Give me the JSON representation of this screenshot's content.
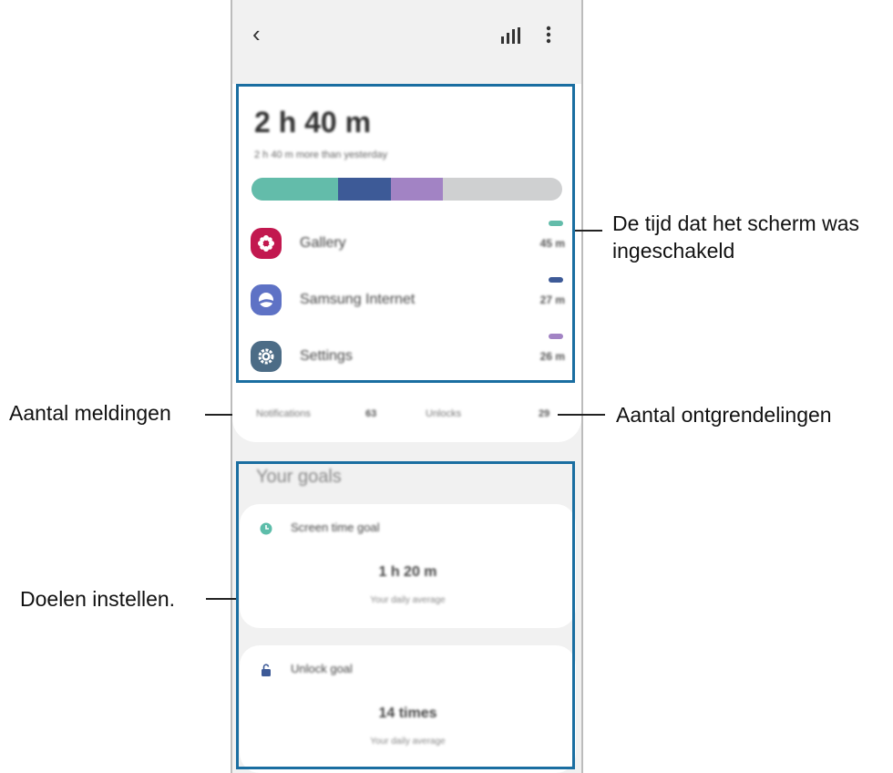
{
  "header": {
    "back_glyph": "‹",
    "stats_icon": "bar-chart-icon",
    "more_icon": "more-vertical-icon"
  },
  "summary": {
    "total_time": "2 h 40 m",
    "comparison": "2 h 40 m more than yesterday",
    "usage_segments": [
      {
        "app": "Gallery",
        "color": "#63bcaa",
        "fraction": 0.28
      },
      {
        "app": "Samsung Internet",
        "color": "#3d5a97",
        "fraction": 0.17
      },
      {
        "app": "Settings",
        "color": "#a283c4",
        "fraction": 0.165
      }
    ],
    "bar_remaining_color": "#cfd0d1"
  },
  "apps": [
    {
      "name": "Gallery",
      "time": "45 m",
      "icon": "gallery-icon",
      "icon_color": "#c2184f",
      "bar_color": "#63bcaa"
    },
    {
      "name": "Samsung Internet",
      "time": "27 m",
      "icon": "samsung-internet-icon",
      "icon_color": "#5e72c5",
      "bar_color": "#3d5a97"
    },
    {
      "name": "Settings",
      "time": "26 m",
      "icon": "settings-icon",
      "icon_color": "#4c6c86",
      "bar_color": "#a283c4"
    }
  ],
  "stats": {
    "notifications_label": "Notifications",
    "notifications_value": "63",
    "unlocks_label": "Unlocks",
    "unlocks_value": "29"
  },
  "goals": {
    "title": "Your goals",
    "screen_time": {
      "name": "Screen time goal",
      "value": "1 h 20 m",
      "caption": "Your daily average",
      "icon": "clock-icon"
    },
    "unlock": {
      "name": "Unlock goal",
      "value": "14 times",
      "caption": "Your daily average",
      "icon": "unlock-icon"
    }
  },
  "callouts": {
    "screen_time_line1": "De tijd dat het scherm was",
    "screen_time_line2": "ingeschakeld",
    "notifications": "Aantal meldingen",
    "unlocks": "Aantal ontgrendelingen",
    "goals": "Doelen instellen."
  },
  "colors": {
    "highlight": "#1a6ea1",
    "goal_icon": "#5dbdaa",
    "unlock_icon": "#3d5a97"
  }
}
